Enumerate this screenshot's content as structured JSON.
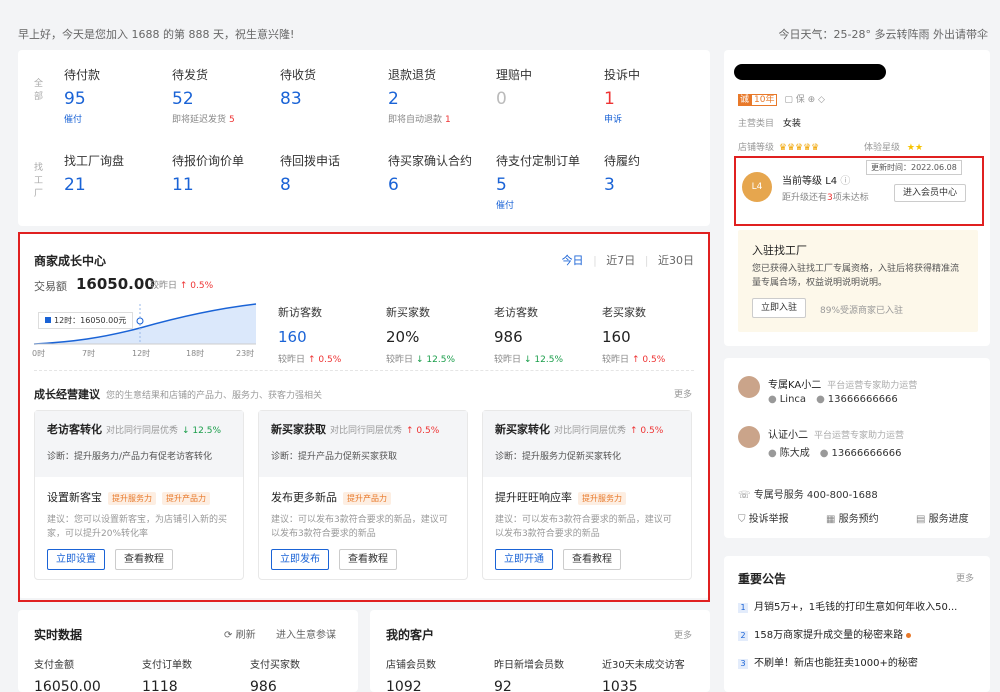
{
  "topbar": {
    "greeting": "早上好，今天是您加入 1688 的第 888 天，祝生意兴隆!",
    "weather": "今日天气：25-28° 多云转阵雨 外出请带伞"
  },
  "orders": {
    "row1_label": "全部",
    "row2_label": "找工厂",
    "row1": [
      {
        "label": "待付款",
        "value": "95",
        "sub": "催付",
        "sub_style": "blue"
      },
      {
        "label": "待发货",
        "value": "52",
        "sub": "即将延迟发货",
        "sub_num": "5"
      },
      {
        "label": "待收货",
        "value": "83",
        "sub": ""
      },
      {
        "label": "退款退货",
        "value": "2",
        "sub": "即将自动退款",
        "sub_num": "1"
      },
      {
        "label": "理赔中",
        "value": "0",
        "sub": "",
        "style": "gray"
      },
      {
        "label": "投诉中",
        "value": "1",
        "sub": "申诉",
        "style": "red",
        "sub_style": "blue"
      }
    ],
    "row2": [
      {
        "label": "找工厂询盘",
        "value": "21",
        "sub": ""
      },
      {
        "label": "待报价询价单",
        "value": "11",
        "sub": ""
      },
      {
        "label": "待回拨申话",
        "value": "8",
        "sub": ""
      },
      {
        "label": "待买家确认合约",
        "value": "6",
        "sub": ""
      },
      {
        "label": "待支付定制订单",
        "value": "5",
        "sub": "催付",
        "sub_style": "blue"
      },
      {
        "label": "待履约",
        "value": "3",
        "sub": ""
      }
    ]
  },
  "growth": {
    "title": "商家成长中心",
    "tabs": [
      "今日",
      "近7日",
      "近30日"
    ],
    "txn_label": "交易额",
    "txn_value": "16050.00",
    "txn_cmp": "较昨日",
    "txn_pct": "↑ 0.5%",
    "tooltip": "12时：16050.00元",
    "xticks": [
      "0时",
      "7时",
      "12时",
      "18时",
      "23时"
    ],
    "metrics": [
      {
        "label": "新访客数",
        "value": "160",
        "cmp": "较昨日",
        "pct": "↑ 0.5%",
        "dir": "up",
        "blue": true
      },
      {
        "label": "新买家数",
        "value": "20%",
        "cmp": "较昨日",
        "pct": "↓ 12.5%",
        "dir": "down"
      },
      {
        "label": "老访客数",
        "value": "986",
        "cmp": "较昨日",
        "pct": "↓ 12.5%",
        "dir": "down"
      },
      {
        "label": "老买家数",
        "value": "160",
        "cmp": "较昨日",
        "pct": "↑ 0.5%",
        "dir": "up"
      }
    ],
    "advice_title": "成长经营建议",
    "advice_sub": "您的生意结果和店铺的产品力、服务力、获客力强相关",
    "more": "更多",
    "cards": [
      {
        "title": "老访客转化",
        "cmp": "对比同行同层优秀",
        "pct": "↓ 12.5%",
        "dir": "down",
        "diag": "诊断：提升服务力/产品力有促老访客转化",
        "action": "设置新客宝",
        "tags": [
          "提升服务力",
          "提升产品力"
        ],
        "advice": "建议：您可以设置新客宝，为店铺引入新的买家，可以提升20%转化率",
        "b1": "立即设置",
        "b2": "查看教程"
      },
      {
        "title": "新买家获取",
        "cmp": "对比同行同层优秀",
        "pct": "↑ 0.5%",
        "dir": "up",
        "diag": "诊断：提升产品力促新买家获取",
        "action": "发布更多新品",
        "tags": [
          "提升产品力"
        ],
        "advice": "建议：可以发布3款符合要求的新品，建议可以发布3款符合要求的新品",
        "b1": "立即发布",
        "b2": "查看教程"
      },
      {
        "title": "新买家转化",
        "cmp": "对比同行同层优秀",
        "pct": "↑ 0.5%",
        "dir": "up",
        "diag": "诊断：提升服务力促新买家转化",
        "action": "提升旺旺响应率",
        "tags": [
          "提升服务力"
        ],
        "advice": "建议：可以发布3款符合要求的新品，建议可以发布3款符合要求的新品",
        "b1": "立即开通",
        "b2": "查看教程"
      }
    ]
  },
  "realtime": {
    "title": "实时数据",
    "refresh": "刷新",
    "enter": "进入生意参谋",
    "cols": [
      {
        "label": "支付金额",
        "value": "16050.00"
      },
      {
        "label": "支付订单数",
        "value": "1118"
      },
      {
        "label": "支付买家数",
        "value": "986"
      }
    ]
  },
  "customers": {
    "title": "我的客户",
    "more": "更多",
    "cols": [
      {
        "label": "店铺会员数",
        "value": "1092"
      },
      {
        "label": "昨日新增会员数",
        "value": "92"
      },
      {
        "label": "近30天未成交访客",
        "value": "1035"
      }
    ]
  },
  "shop": {
    "badge_years": "10年",
    "category_label": "主营类目",
    "category": "女装",
    "shop_level_label": "店铺等级",
    "exp_level_label": "体验星级",
    "update_time": "更新时间：2022.06.08",
    "level_label": "当前等级",
    "level": "L4",
    "upgrade_prefix": "距升级还有",
    "upgrade_num": "3",
    "upgrade_suffix": "项未达标",
    "member_btn": "进入会员中心"
  },
  "factory": {
    "title": "入驻找工厂",
    "desc": "您已获得入驻找工厂专属资格，入驻后将获得精准流量专属合场，权益说明说明说明。",
    "btn": "立即入驻",
    "note": "89%受源商家已入驻"
  },
  "service": {
    "kas": [
      {
        "role": "专属KA小二",
        "desc": "平台运营专家助力运营",
        "name": "Linca",
        "phone": "13666666666"
      },
      {
        "role": "认证小二",
        "desc": "平台运营专家助力运营",
        "name": "陈大成",
        "phone": "13666666666"
      }
    ],
    "hotline": "专属号服务  400-800-1688",
    "links": [
      "投诉举报",
      "服务预约",
      "服务进度"
    ]
  },
  "notices": {
    "title": "重要公告",
    "more": "更多",
    "items": [
      "月销5万+，1毛钱的打印生意如何年收入50...",
      "158万商家提升成交量的秘密来路",
      "不刷单！新店也能狂卖1000+的秘密"
    ]
  },
  "colors": {
    "accent": "#1a63d6",
    "up": "#e33333",
    "down": "#1b9e4b",
    "highlight": "#e02020"
  }
}
